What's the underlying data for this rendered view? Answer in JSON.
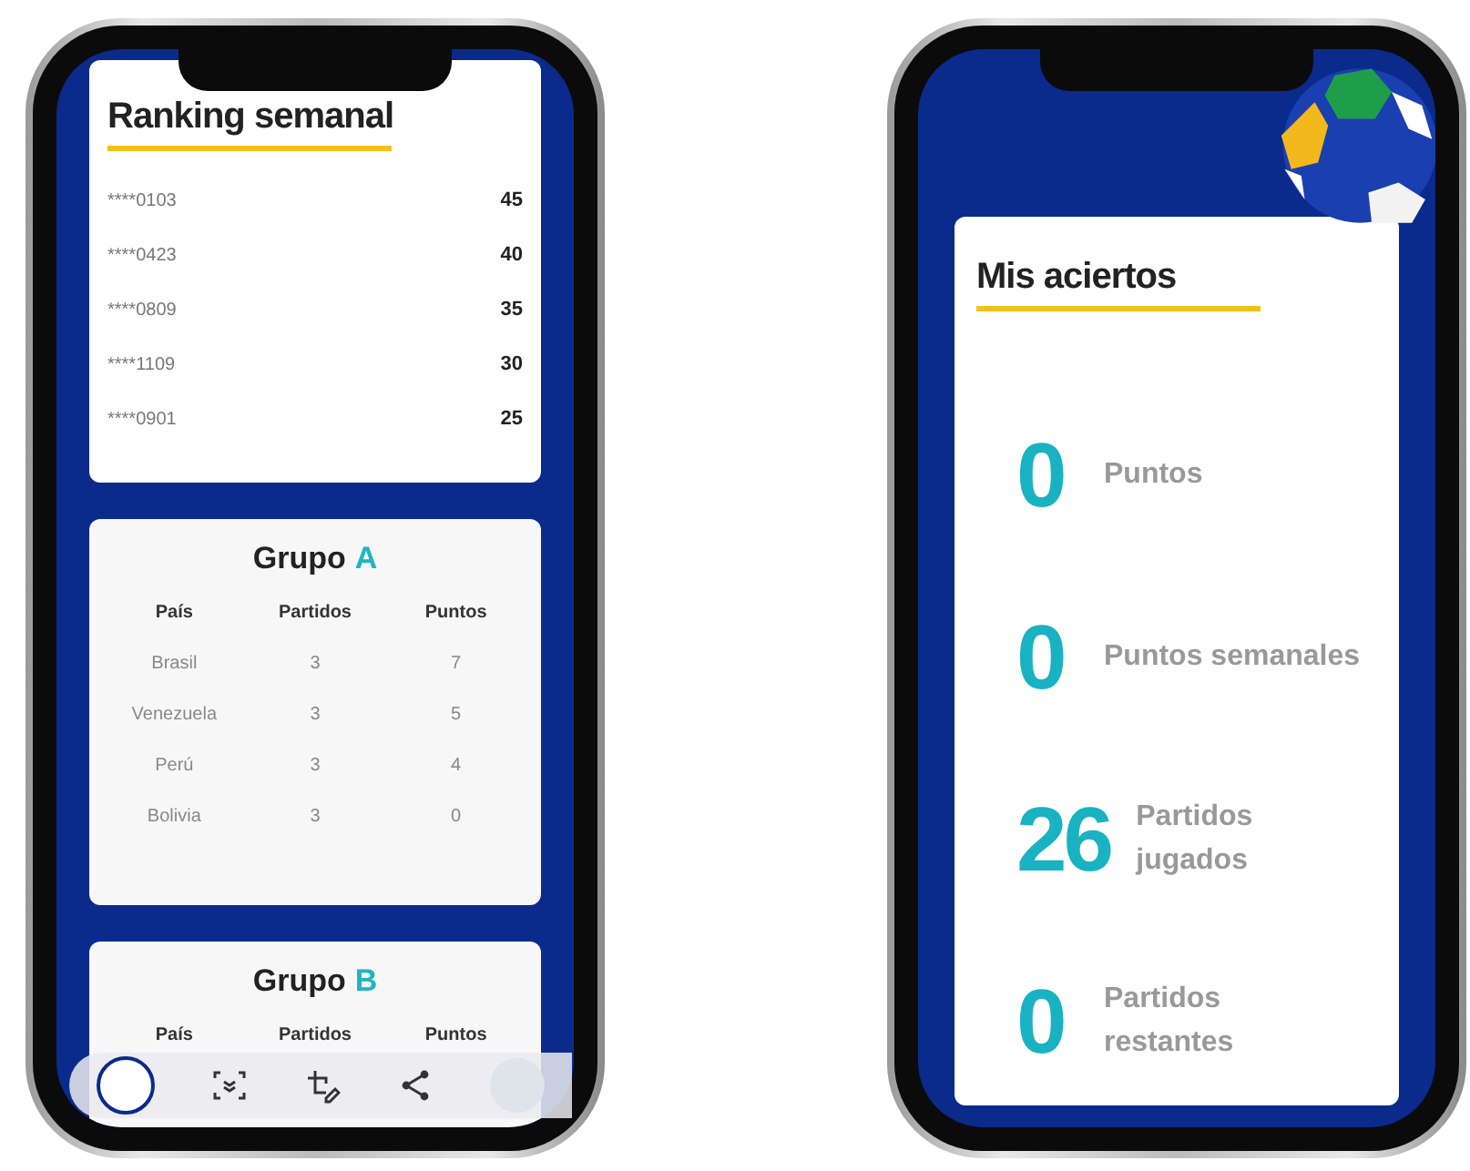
{
  "left_phone": {
    "ranking": {
      "title": "Ranking semanal",
      "rows": [
        {
          "user": "****0103",
          "points": "45"
        },
        {
          "user": "****0423",
          "points": "40"
        },
        {
          "user": "****0809",
          "points": "35"
        },
        {
          "user": "****1109",
          "points": "30"
        },
        {
          "user": "****0901",
          "points": "25"
        }
      ]
    },
    "groups": [
      {
        "title": "Grupo",
        "letter": "A",
        "columns": [
          "País",
          "Partidos",
          "Puntos"
        ],
        "rows": [
          [
            "Brasil",
            "3",
            "7"
          ],
          [
            "Venezuela",
            "3",
            "5"
          ],
          [
            "Perú",
            "3",
            "4"
          ],
          [
            "Bolivia",
            "3",
            "0"
          ]
        ]
      },
      {
        "title": "Grupo",
        "letter": "B",
        "columns": [
          "País",
          "Partidos",
          "Puntos"
        ]
      }
    ]
  },
  "right_phone": {
    "title": "Mis aciertos",
    "stats": [
      {
        "value": "0",
        "label": "Puntos"
      },
      {
        "value": "0",
        "label": "Puntos semanales"
      },
      {
        "value": "26",
        "label": "Partidos jugados"
      },
      {
        "value": "0",
        "label": "Partidos restantes"
      }
    ]
  }
}
